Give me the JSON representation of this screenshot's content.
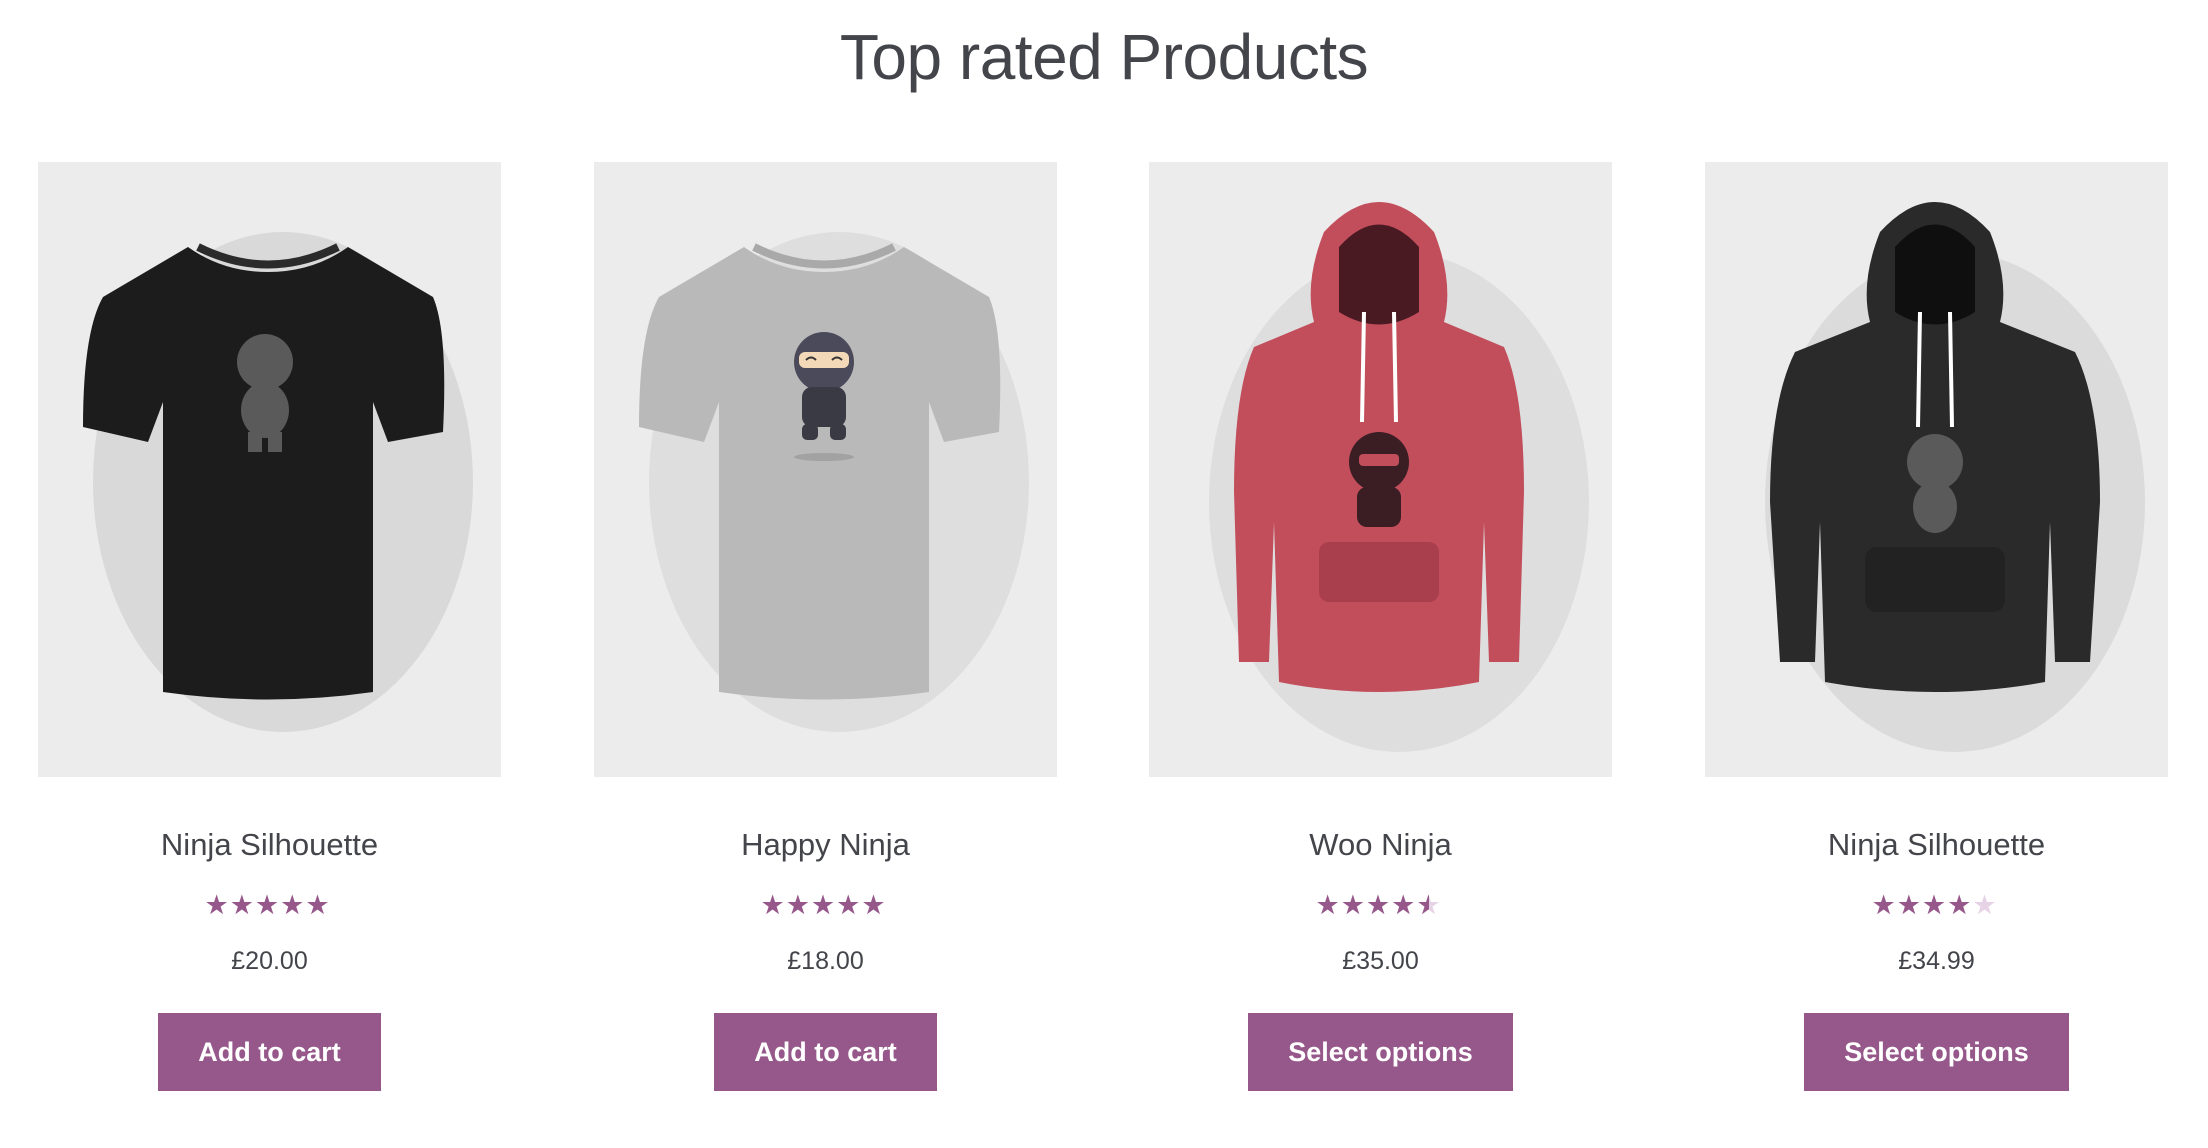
{
  "section": {
    "title": "Top rated Products"
  },
  "colors": {
    "accent": "#96588a",
    "star_empty": "#e6d3e6",
    "image_bg": "#ececec",
    "text": "#43454b"
  },
  "products": [
    {
      "name": "Ninja Silhouette",
      "price": "£20.00",
      "rating": 5,
      "rating_max": 5,
      "button": "Add to cart",
      "image": "black-tshirt-silhouette"
    },
    {
      "name": "Happy Ninja",
      "price": "£18.00",
      "rating": 5,
      "rating_max": 5,
      "button": "Add to cart",
      "image": "grey-tshirt-ninja"
    },
    {
      "name": "Woo Ninja",
      "price": "£35.00",
      "rating": 4.5,
      "rating_max": 5,
      "button": "Select options",
      "image": "red-hoodie-ninja"
    },
    {
      "name": "Ninja Silhouette",
      "price": "£34.99",
      "rating": 4,
      "rating_max": 5,
      "button": "Select options",
      "image": "black-hoodie-silhouette"
    }
  ]
}
